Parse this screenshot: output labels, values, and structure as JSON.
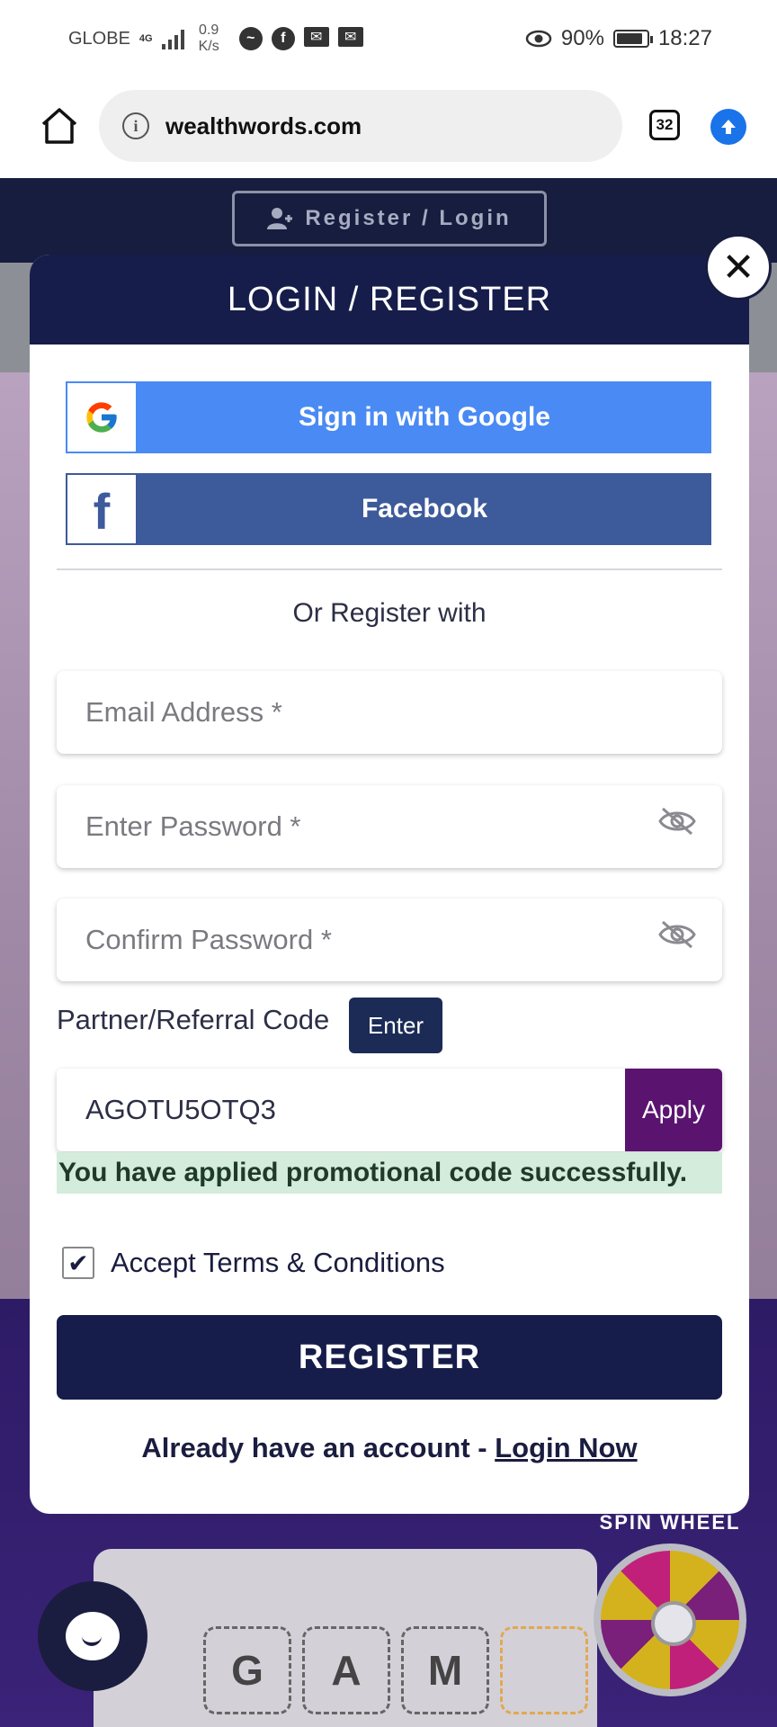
{
  "status_bar": {
    "carrier": "GLOBE",
    "network": "4G",
    "speed_value": "0.9",
    "speed_unit": "K/s",
    "battery": "90%",
    "time": "18:27"
  },
  "browser": {
    "url": "wealthwords.com",
    "tab_count": "32"
  },
  "page": {
    "nav_button": "Register / Login",
    "game_letters": [
      "G",
      "A",
      "M",
      ""
    ],
    "wheel_label": "SPIN WHEEL"
  },
  "modal": {
    "title": "LOGIN / REGISTER",
    "close": "✕",
    "google_label": "Sign in with Google",
    "facebook_label": "Facebook",
    "or_text": "Or Register with",
    "email_placeholder": "Email Address *",
    "password_placeholder": "Enter Password *",
    "confirm_placeholder": "Confirm Password *",
    "referral_label": "Partner/Referral Code",
    "enter_label": "Enter",
    "referral_value": "AGOTU5OTQ3",
    "apply_label": "Apply",
    "success_message": "You have applied promotional code successfully.",
    "terms_label": "Accept Terms & Conditions",
    "terms_checked": true,
    "register_label": "REGISTER",
    "already_text": "Already have an account - ",
    "login_link": "Login Now"
  },
  "colors": {
    "navy": "#161d4b",
    "google_blue": "#4a8af4",
    "facebook_blue": "#3d5a9b",
    "apply_purple": "#5a1470",
    "success_bg": "#d4ecdb"
  }
}
